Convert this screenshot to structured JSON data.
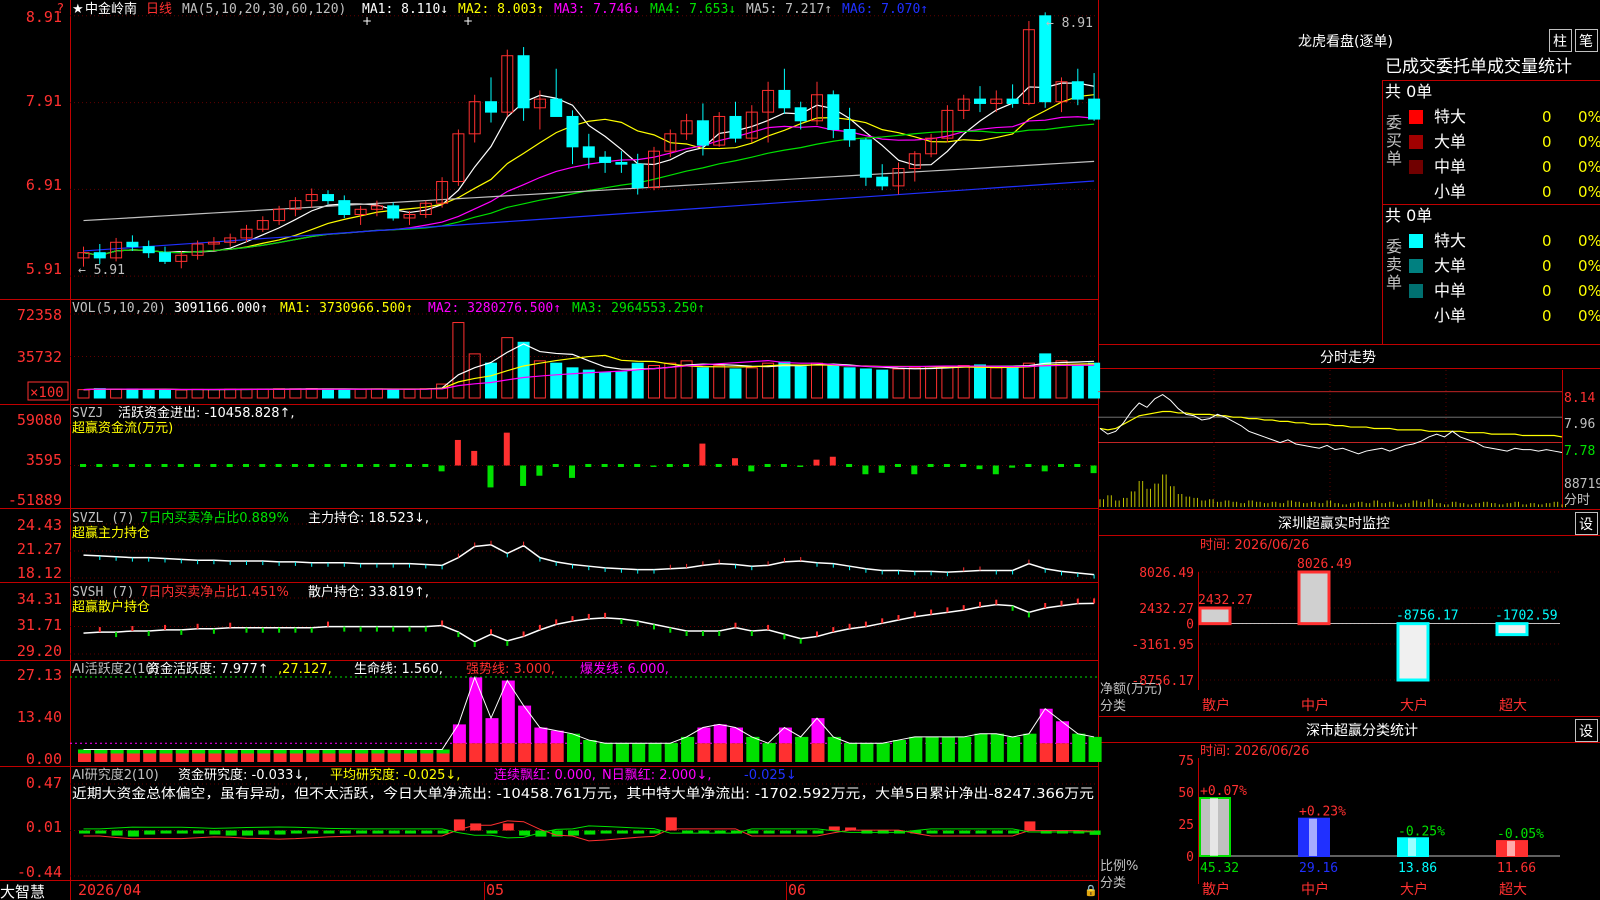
{
  "colors": {
    "bg": "#000000",
    "border": "#c00000",
    "up": "#ff3030",
    "down": "#00ffff",
    "green": "#00e000",
    "white": "#ffffff",
    "yellow": "#ffff00",
    "magenta": "#ff00ff",
    "blue": "#2030ff",
    "gray": "#c0c0c0",
    "axis": "#ff3030"
  },
  "header": {
    "marker": "?",
    "star": "★",
    "stock_name": "中金岭南",
    "period": "日线",
    "ma_spec": "MA(5,10,20,30,60,120)",
    "mas": [
      {
        "label": "MA1: 8.110↓",
        "color": "#ffffff"
      },
      {
        "label": "MA2: 8.003↑",
        "color": "#ffff00"
      },
      {
        "label": "MA3: 7.746↓",
        "color": "#ff00ff"
      },
      {
        "label": "MA4: 7.653↓",
        "color": "#00e000"
      },
      {
        "label": "MA5: 7.217↑",
        "color": "#c0c0c0"
      },
      {
        "label": "MA6: 7.070↑",
        "color": "#2030ff"
      }
    ]
  },
  "main_chart": {
    "y_ticks": [
      "8.91",
      "7.91",
      "6.91",
      "5.91"
    ],
    "high_label": "8.91",
    "low_label": "5.91",
    "ylim": [
      5.75,
      9.0
    ]
  },
  "chart_data": [
    {
      "type": "candlestick",
      "name": "中金岭南 日线",
      "ylim": [
        5.75,
        9.0
      ],
      "candles": [
        [
          6.12,
          6.25,
          6.02,
          6.18
        ],
        [
          6.18,
          6.28,
          6.05,
          6.12
        ],
        [
          6.12,
          6.35,
          6.08,
          6.3
        ],
        [
          6.3,
          6.38,
          6.2,
          6.25
        ],
        [
          6.25,
          6.32,
          6.12,
          6.18
        ],
        [
          6.18,
          6.25,
          6.05,
          6.08
        ],
        [
          6.08,
          6.2,
          6.0,
          6.15
        ],
        [
          6.15,
          6.32,
          6.1,
          6.28
        ],
        [
          6.28,
          6.36,
          6.2,
          6.3
        ],
        [
          6.3,
          6.4,
          6.25,
          6.35
        ],
        [
          6.35,
          6.5,
          6.3,
          6.45
        ],
        [
          6.45,
          6.6,
          6.42,
          6.55
        ],
        [
          6.55,
          6.72,
          6.5,
          6.68
        ],
        [
          6.68,
          6.82,
          6.6,
          6.78
        ],
        [
          6.78,
          6.92,
          6.7,
          6.85
        ],
        [
          6.85,
          6.9,
          6.74,
          6.78
        ],
        [
          6.78,
          6.84,
          6.58,
          6.62
        ],
        [
          6.62,
          6.72,
          6.5,
          6.68
        ],
        [
          6.68,
          6.78,
          6.6,
          6.72
        ],
        [
          6.72,
          6.76,
          6.55,
          6.58
        ],
        [
          6.58,
          6.66,
          6.5,
          6.62
        ],
        [
          6.62,
          6.78,
          6.58,
          6.75
        ],
        [
          6.75,
          7.05,
          6.7,
          7.0
        ],
        [
          7.0,
          7.6,
          6.95,
          7.55
        ],
        [
          7.55,
          8.0,
          7.45,
          7.92
        ],
        [
          7.92,
          8.2,
          7.68,
          7.8
        ],
        [
          7.8,
          8.52,
          7.75,
          8.45
        ],
        [
          8.45,
          8.55,
          7.7,
          7.85
        ],
        [
          7.85,
          8.05,
          7.6,
          7.95
        ],
        [
          7.95,
          8.3,
          7.75,
          7.75
        ],
        [
          7.75,
          7.82,
          7.2,
          7.4
        ],
        [
          7.4,
          7.55,
          7.15,
          7.28
        ],
        [
          7.28,
          7.35,
          7.1,
          7.22
        ],
        [
          7.22,
          7.35,
          7.1,
          7.2
        ],
        [
          7.2,
          7.32,
          6.85,
          6.93
        ],
        [
          6.93,
          7.4,
          6.9,
          7.35
        ],
        [
          7.35,
          7.6,
          7.28,
          7.55
        ],
        [
          7.55,
          7.78,
          7.48,
          7.7
        ],
        [
          7.7,
          7.9,
          7.3,
          7.42
        ],
        [
          7.42,
          7.8,
          7.4,
          7.75
        ],
        [
          7.75,
          7.92,
          7.45,
          7.5
        ],
        [
          7.5,
          7.88,
          7.45,
          7.8
        ],
        [
          7.8,
          8.15,
          7.45,
          8.05
        ],
        [
          8.05,
          8.3,
          7.78,
          7.85
        ],
        [
          7.85,
          7.92,
          7.6,
          7.7
        ],
        [
          7.7,
          8.15,
          7.65,
          8.0
        ],
        [
          8.0,
          8.05,
          7.5,
          7.6
        ],
        [
          7.6,
          7.85,
          7.4,
          7.48
        ],
        [
          7.48,
          7.5,
          6.95,
          7.05
        ],
        [
          7.05,
          7.2,
          6.9,
          6.95
        ],
        [
          6.95,
          7.22,
          6.85,
          7.15
        ],
        [
          7.15,
          7.35,
          7.0,
          7.32
        ],
        [
          7.32,
          7.55,
          7.28,
          7.5
        ],
        [
          7.5,
          7.88,
          7.45,
          7.82
        ],
        [
          7.82,
          8.0,
          7.72,
          7.95
        ],
        [
          7.95,
          8.1,
          7.8,
          7.9
        ],
        [
          7.9,
          8.05,
          7.8,
          7.95
        ],
        [
          7.95,
          8.12,
          7.85,
          7.9
        ],
        [
          7.9,
          8.85,
          7.88,
          8.75
        ],
        [
          8.91,
          8.95,
          7.85,
          7.92
        ],
        [
          7.92,
          8.2,
          7.8,
          8.15
        ],
        [
          8.15,
          8.3,
          7.88,
          7.95
        ],
        [
          7.95,
          8.25,
          7.7,
          7.72
        ]
      ]
    },
    {
      "type": "bar",
      "name": "VOL",
      "ylim": [
        0,
        72358
      ],
      "unit_label": "×100",
      "values": [
        7200,
        8100,
        7500,
        7800,
        7000,
        7200,
        6900,
        7400,
        7300,
        7600,
        7500,
        7700,
        8000,
        7900,
        8100,
        7800,
        7600,
        7500,
        7800,
        7600,
        7400,
        8000,
        12000,
        65000,
        38000,
        30000,
        52000,
        48000,
        32000,
        30000,
        26000,
        24000,
        22000,
        22500,
        30000,
        28000,
        30000,
        32000,
        26000,
        28000,
        25000,
        26000,
        30000,
        31000,
        27000,
        30000,
        28000,
        26000,
        25000,
        24000,
        25000,
        26000,
        27000,
        27500,
        28000,
        28500,
        26000,
        27000,
        30000,
        38000,
        32000,
        28000,
        30000
      ]
    },
    {
      "type": "bar",
      "name": "超赢资金流(万元)",
      "ylim": [
        -51889,
        59080
      ],
      "values": [
        0,
        0,
        0,
        0,
        0,
        0,
        0,
        0,
        0,
        0,
        0,
        0,
        0,
        0,
        0,
        0,
        0,
        0,
        0,
        0,
        0,
        0,
        -8000,
        35000,
        20000,
        -30000,
        45000,
        -28000,
        -14000,
        0,
        -17000,
        0,
        0,
        0,
        0,
        -2000,
        0,
        0,
        30000,
        0,
        10000,
        -8000,
        0,
        0,
        -2000,
        8000,
        12000,
        0,
        -12000,
        -10000,
        0,
        -12000,
        0,
        0,
        0,
        -5000,
        -12000,
        -3000,
        0,
        -8000,
        0,
        0,
        -10458
      ]
    },
    {
      "type": "line",
      "name": "超赢主力持仓",
      "ylim": [
        18.12,
        24.43
      ],
      "values": [
        20.8,
        20.7,
        20.6,
        20.5,
        20.5,
        20.4,
        20.3,
        20.2,
        20.2,
        20.1,
        20.1,
        20.1,
        20.0,
        20.0,
        19.9,
        19.9,
        19.9,
        19.8,
        19.8,
        19.8,
        19.8,
        19.7,
        19.6,
        20.5,
        21.8,
        22.0,
        21.0,
        21.9,
        20.5,
        20.0,
        19.7,
        19.5,
        19.3,
        19.2,
        19.1,
        19.1,
        19.2,
        19.3,
        19.6,
        19.8,
        19.7,
        19.5,
        19.6,
        20.0,
        20.1,
        19.9,
        19.8,
        19.5,
        19.2,
        19.0,
        19.0,
        18.9,
        18.9,
        18.8,
        18.9,
        19.0,
        19.0,
        19.0,
        19.8,
        19.2,
        18.9,
        18.7,
        18.52
      ]
    },
    {
      "type": "line",
      "name": "超赢散户持仓",
      "ylim": [
        29.2,
        34.31
      ],
      "values": [
        31.1,
        31.2,
        31.2,
        31.3,
        31.3,
        31.4,
        31.4,
        31.5,
        31.5,
        31.6,
        31.6,
        31.6,
        31.6,
        31.6,
        31.6,
        31.7,
        31.7,
        31.7,
        31.7,
        31.7,
        31.7,
        31.7,
        31.8,
        31.2,
        30.3,
        31.0,
        30.4,
        30.8,
        31.4,
        31.9,
        32.2,
        32.4,
        32.5,
        32.4,
        32.2,
        31.9,
        31.6,
        31.3,
        31.3,
        31.3,
        31.6,
        31.3,
        31.4,
        31.0,
        30.6,
        30.8,
        31.2,
        31.5,
        31.7,
        32.0,
        32.3,
        32.6,
        32.8,
        33.0,
        33.2,
        33.5,
        33.7,
        33.6,
        33.0,
        33.4,
        33.6,
        33.8,
        33.819
      ]
    },
    {
      "type": "bar",
      "name": "AI活跃度2",
      "ylim": [
        0,
        27.13
      ],
      "strong_line": 3.0,
      "burst_line": 6.0,
      "values": [
        4,
        4,
        4,
        4,
        4,
        4,
        4,
        4,
        4,
        4,
        4,
        4,
        4,
        4,
        4,
        4,
        4,
        4,
        4,
        4,
        4,
        4,
        4,
        12,
        27,
        14,
        26,
        18,
        11,
        10,
        9,
        7,
        6,
        6,
        6,
        6,
        6,
        8,
        11,
        12,
        11,
        8,
        6,
        11,
        8,
        14,
        8,
        6,
        6,
        6,
        7,
        8,
        8,
        8,
        8,
        9,
        9,
        8,
        9,
        17,
        13,
        9,
        8
      ]
    },
    {
      "type": "bar",
      "name": "AI研究度2",
      "ylim": [
        -0.44,
        0.47
      ],
      "values": [
        -0.02,
        -0.02,
        -0.04,
        -0.05,
        -0.03,
        -0.02,
        -0.02,
        -0.02,
        -0.03,
        -0.04,
        -0.04,
        -0.03,
        -0.03,
        -0.02,
        -0.02,
        -0.02,
        -0.02,
        -0.02,
        -0.02,
        -0.02,
        -0.02,
        -0.02,
        -0.02,
        0.12,
        0.08,
        -0.02,
        0.08,
        -0.04,
        -0.05,
        -0.05,
        -0.04,
        -0.03,
        -0.02,
        -0.02,
        -0.02,
        -0.02,
        0.14,
        -0.02,
        -0.02,
        -0.02,
        -0.02,
        -0.02,
        -0.02,
        -0.02,
        -0.02,
        -0.02,
        0.05,
        0.04,
        -0.02,
        -0.02,
        -0.02,
        -0.02,
        -0.02,
        -0.02,
        -0.02,
        -0.02,
        -0.02,
        -0.02,
        0.1,
        -0.02,
        -0.02,
        -0.02,
        -0.033
      ]
    }
  ],
  "vol_panel": {
    "title": "VOL(5,10,20)",
    "value": "3091166.000↑",
    "ma1": "MA1: 3730966.500↑",
    "ma2": "MA2: 3280276.500↑",
    "ma3": "MA3: 2964553.250↑",
    "y_ticks": [
      "72358",
      "35732"
    ],
    "unit": "×100"
  },
  "svzj_panel": {
    "title": "SVZJ",
    "desc": "活跃资金进出: -10458.828↑,",
    "subtitle": "超赢资金流(万元)",
    "y_ticks": [
      "59080",
      "3595",
      "-51889"
    ]
  },
  "svzl_panel": {
    "title": "SVZL (7)",
    "desc": "7日内买卖净占比0.889%",
    "desc2": "主力持仓: 18.523↓,",
    "subtitle": "超赢主力持仓",
    "y_ticks": [
      "24.43",
      "21.27",
      "18.12"
    ]
  },
  "svsh_panel": {
    "title": "SVSH (7)",
    "desc": "7日内买卖净占比1.451%",
    "desc2": "散户持仓: 33.819↑,",
    "subtitle": "超赢散户持仓",
    "y_ticks": [
      "34.31",
      "31.71",
      "29.20"
    ]
  },
  "ai1_panel": {
    "title": "AI活跃度2(10)",
    "t1": "资金活跃度: 7.977↑",
    "t2": ",27.127,",
    "t3": "生命线: 1.560,",
    "t4": "强势线: 3.000,",
    "t5": "爆发线: 6.000,",
    "y_ticks": [
      "27.13",
      "13.40",
      "0.00"
    ]
  },
  "ai2_panel": {
    "title": "AI研究度2(10)",
    "t1": "资金研究度: -0.033↓,",
    "t2": "平均研究度: -0.025↓,",
    "t3": "连续飘红: 0.000,",
    "t4": "N日飘红: 2.000↓,",
    "t5": "-0.025↓",
    "note": "近期大资金总体偏空，虽有异动，但不太活跃，今日大单净流出: -10458.761万元，其中特大单净流出: -1702.592万元，大单5日累计净出-8247.366万元",
    "y_ticks": [
      "0.47",
      "0.01",
      "-0.44"
    ]
  },
  "xaxis": {
    "start_date": "2026/04",
    "labels": [
      "05",
      "06"
    ],
    "brand": "大智慧"
  },
  "right": {
    "lhkp": {
      "title": "龙虎看盘(逐单)",
      "btn1": "柱",
      "btn2": "笔",
      "header": "已成交委托单成交量统计",
      "buy_label": "委买单",
      "buy_total": "共 0单",
      "buy_rows": [
        {
          "label": "特大",
          "v": "0",
          "p": "0%",
          "color": "#ff0000"
        },
        {
          "label": "大单",
          "v": "0",
          "p": "0%",
          "color": "#a00000"
        },
        {
          "label": "中单",
          "v": "0",
          "p": "0%",
          "color": "#700000"
        },
        {
          "label": "小单",
          "v": "0",
          "p": "0%",
          "color": ""
        }
      ],
      "sell_label": "委卖单",
      "sell_total": "共 0单",
      "sell_rows": [
        {
          "label": "特大",
          "v": "0",
          "p": "0%",
          "color": "#00ffff"
        },
        {
          "label": "大单",
          "v": "0",
          "p": "0%",
          "color": "#008080"
        },
        {
          "label": "中单",
          "v": "0",
          "p": "0%",
          "color": "#007070"
        },
        {
          "label": "小单",
          "v": "0",
          "p": "0%",
          "color": ""
        }
      ]
    },
    "fenshi": {
      "title": "分时走势",
      "y_ticks": [
        "8.14",
        "7.96",
        "7.78"
      ],
      "vol_tick": "88719",
      "vol_unit": "分时",
      "price": [
        7.88,
        7.84,
        7.86,
        7.92,
        8.0,
        8.06,
        8.03,
        8.09,
        8.12,
        8.08,
        8.02,
        7.98,
        7.97,
        7.94,
        7.95,
        7.98,
        7.96,
        7.93,
        7.9,
        7.86,
        7.84,
        7.82,
        7.8,
        7.78,
        7.8,
        7.77,
        7.76,
        7.75,
        7.74,
        7.76,
        7.73,
        7.74,
        7.72,
        7.7,
        7.72,
        7.73,
        7.74,
        7.72,
        7.74,
        7.76,
        7.77,
        7.79,
        7.82,
        7.84,
        7.82,
        7.86,
        7.82,
        7.8,
        7.78,
        7.75,
        7.74,
        7.73,
        7.72,
        7.74,
        7.73,
        7.73,
        7.72,
        7.73,
        7.72,
        7.71
      ],
      "avg": [
        7.88,
        7.87,
        7.88,
        7.91,
        7.94,
        7.97,
        7.98,
        7.99,
        8.0,
        8.0,
        7.99,
        7.99,
        7.98,
        7.98,
        7.98,
        7.97,
        7.97,
        7.96,
        7.96,
        7.95,
        7.95,
        7.94,
        7.94,
        7.93,
        7.93,
        7.92,
        7.92,
        7.91,
        7.91,
        7.91,
        7.9,
        7.9,
        7.89,
        7.89,
        7.89,
        7.88,
        7.88,
        7.88,
        7.87,
        7.87,
        7.87,
        7.87,
        7.86,
        7.86,
        7.86,
        7.86,
        7.86,
        7.85,
        7.85,
        7.85,
        7.84,
        7.84,
        7.84,
        7.84,
        7.83,
        7.83,
        7.83,
        7.83,
        7.83,
        7.82
      ],
      "vol": [
        6,
        9,
        5,
        7,
        12,
        20,
        14,
        18,
        25,
        16,
        10,
        8,
        7,
        5,
        6,
        4,
        5,
        4,
        3,
        5,
        4,
        3,
        4,
        3,
        5,
        4,
        3,
        4,
        3,
        5,
        3,
        2,
        3,
        4,
        3,
        5,
        3,
        4,
        2,
        3,
        5,
        4,
        6,
        3,
        2,
        4,
        3,
        2,
        3,
        4,
        3,
        2,
        3,
        4,
        2,
        3,
        2,
        3,
        4,
        2
      ]
    },
    "szcy": {
      "title": "深圳超赢实时监控",
      "btn": "设",
      "time": "时间: 2026/06/26",
      "y_ticks": [
        "8026.49",
        "2432.27",
        "0",
        "-3161.95",
        "-8756.17"
      ],
      "ylabel": "净额(万元)",
      "xlabel": "分类",
      "cats": [
        "散户",
        "中户",
        "大户",
        "超大"
      ],
      "values": [
        2432.27,
        8026.49,
        -8756.17,
        -1702.59
      ],
      "labels": [
        "2432.27",
        "8026.49",
        "-8756.17",
        "-1702.59"
      ]
    },
    "ssfl": {
      "title": "深市超赢分类统计",
      "btn": "设",
      "time": "时间: 2026/06/26",
      "y_ticks": [
        "75",
        "50",
        "25",
        "0"
      ],
      "ylabel": "比例%",
      "xlabel": "分类",
      "cats": [
        "散户",
        "中户",
        "大户",
        "超大"
      ],
      "values": [
        45.32,
        29.16,
        13.86,
        11.66
      ],
      "values_text": [
        "45.32",
        "29.16",
        "13.86",
        "11.66"
      ],
      "changes": [
        "+0.07%",
        "+0.23%",
        "-0.25%",
        "-0.05%"
      ],
      "fill_colors": [
        "#c0c0c0",
        "#2030ff",
        "#00ffff",
        "#ff3030"
      ],
      "change_colors": [
        "#ff3030",
        "#ff3030",
        "#00e000",
        "#00e000"
      ],
      "value_colors": [
        "#00e000",
        "#2030ff",
        "#00ffff",
        "#ff3030"
      ]
    }
  }
}
